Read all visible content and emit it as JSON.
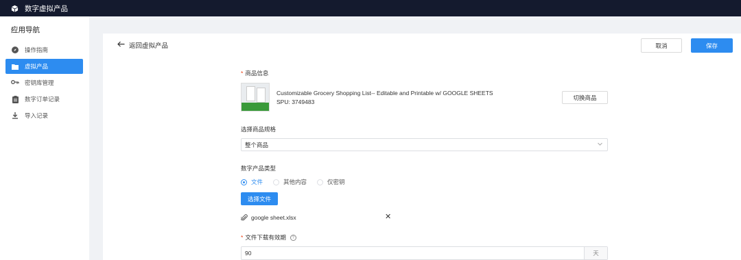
{
  "app": {
    "title": "数字虚拟产品",
    "logo_icon": "box-icon"
  },
  "sidebar": {
    "title": "应用导航",
    "collapse_glyph": "‹",
    "items": [
      {
        "label": "操作指南",
        "icon": "compass-icon",
        "active": false
      },
      {
        "label": "虚拟产品",
        "icon": "folder-icon",
        "active": true
      },
      {
        "label": "密钥库管理",
        "icon": "key-icon",
        "active": false
      },
      {
        "label": "数字订单记录",
        "icon": "clipboard-icon",
        "active": false
      },
      {
        "label": "导入记录",
        "icon": "download-icon",
        "active": false
      }
    ]
  },
  "header": {
    "back_label": "返回虚拟产品",
    "cancel_label": "取消",
    "save_label": "保存"
  },
  "form": {
    "product_info_label": "商品信息",
    "product_name": "Customizable Grocery Shopping List-- Editable and Printable w/ GOOGLE SHEETS",
    "product_spu": "SPU: 3749483",
    "switch_label": "切换商品",
    "spec_label": "选择商品规格",
    "spec_value": "整个商品",
    "type_label": "数字产品类型",
    "type_options": [
      {
        "label": "文件",
        "checked": true
      },
      {
        "label": "其他内容",
        "checked": false
      },
      {
        "label": "仅密钥",
        "checked": false
      }
    ],
    "select_file_label": "选择文件",
    "file_name": "google sheet.xlsx",
    "remove_glyph": "✕",
    "validity_label": "文件下载有效期",
    "validity_help": "?",
    "validity_value": "90",
    "validity_unit": "天"
  },
  "colors": {
    "accent": "#2d8cf0",
    "topbar": "#141a2e",
    "required": "#ed4014"
  }
}
